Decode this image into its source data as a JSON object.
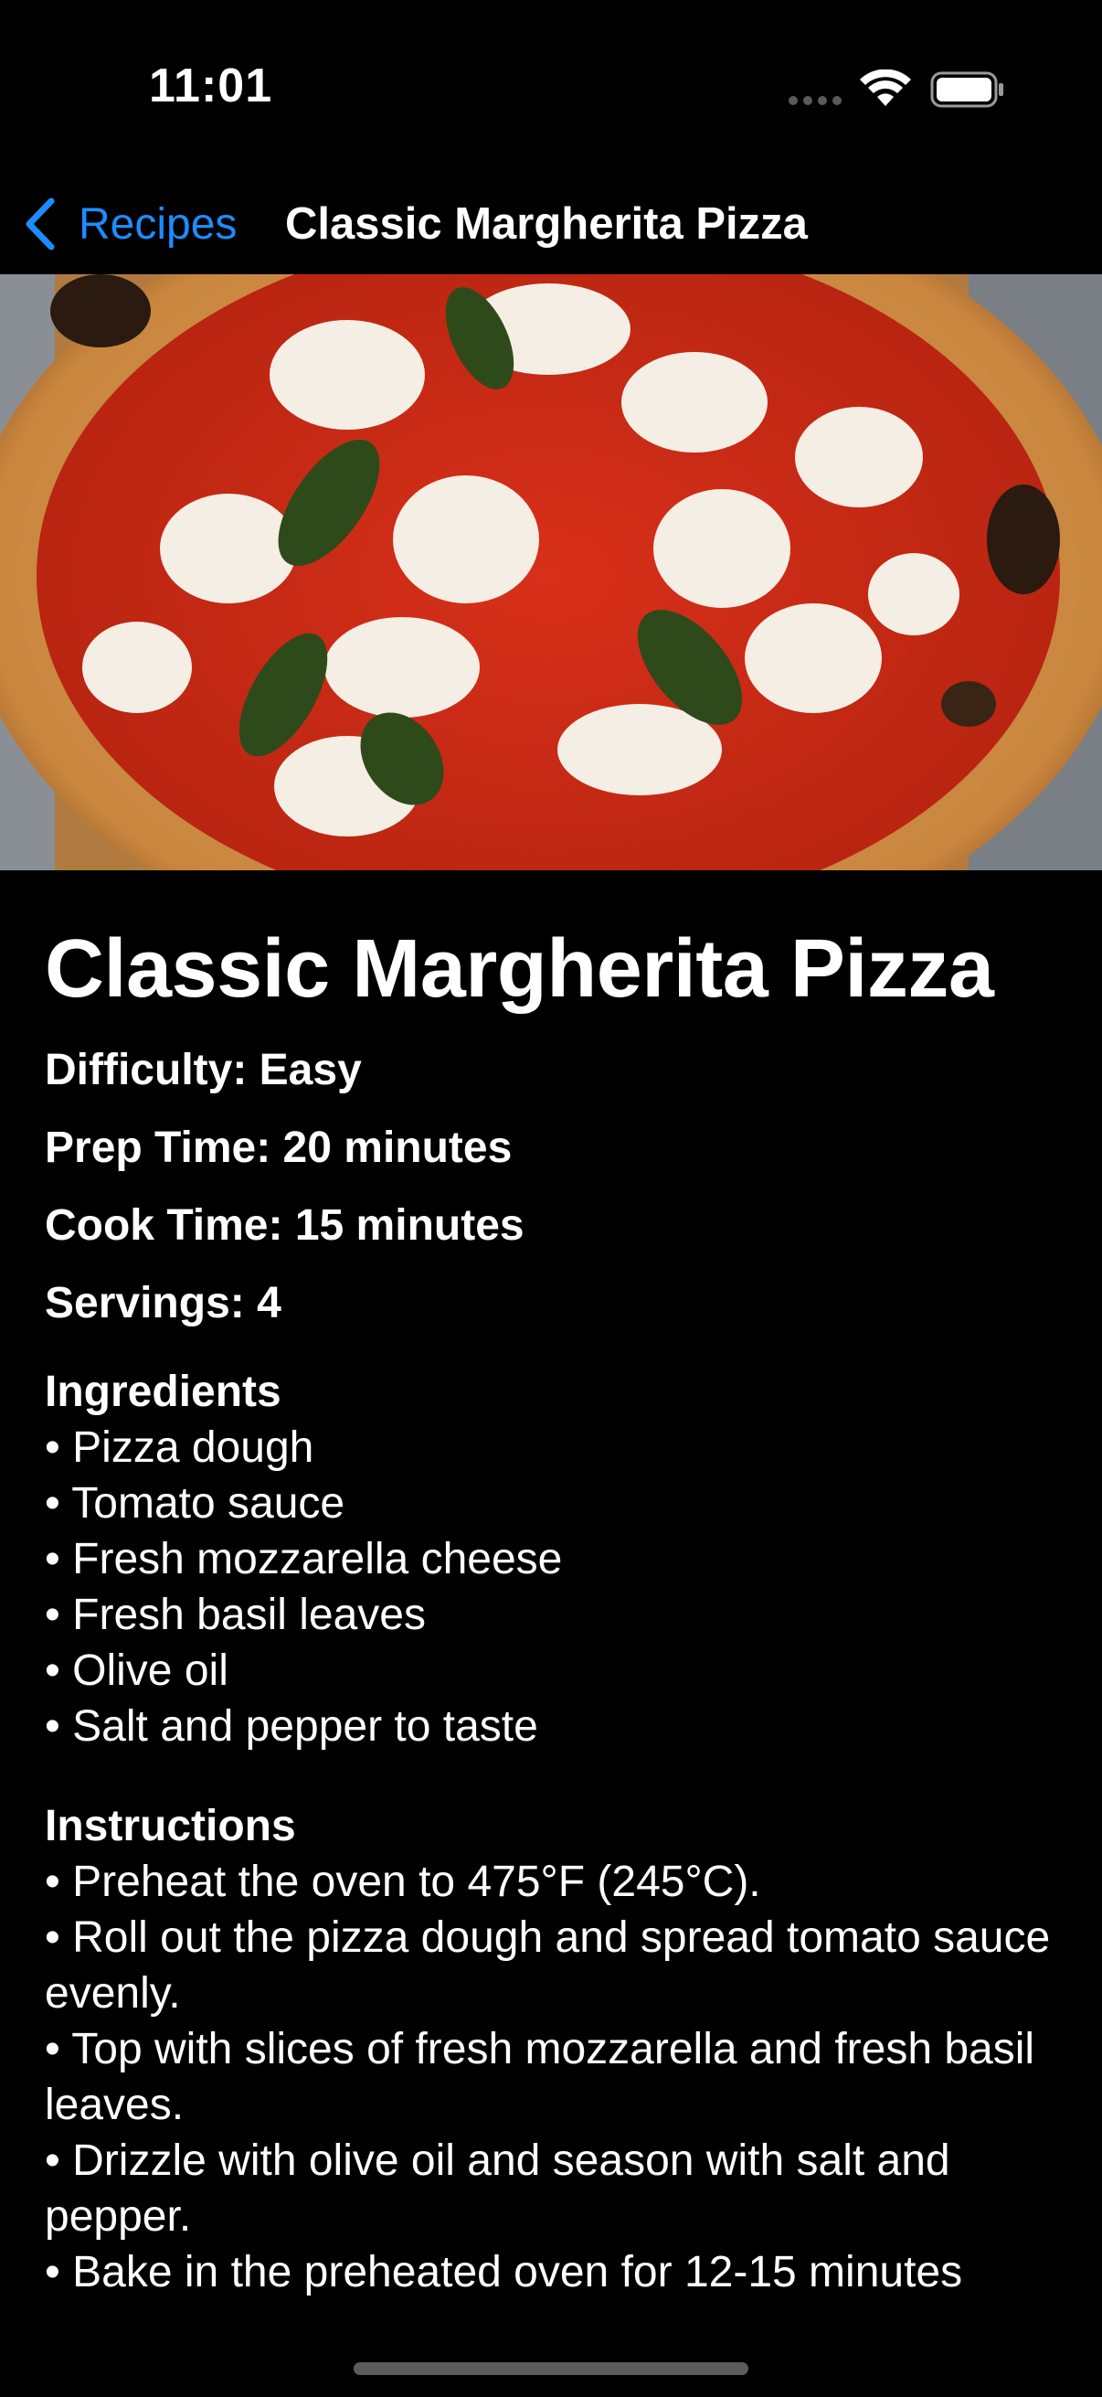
{
  "status_bar": {
    "time": "11:01",
    "icons": [
      "signal-dots-icon",
      "wifi-icon",
      "battery-icon"
    ]
  },
  "nav": {
    "back_label": "Recipes",
    "title": "Classic Margherita Pizza",
    "accent_color": "#1d8cff"
  },
  "hero_image": {
    "subject": "margherita-pizza-photo"
  },
  "recipe": {
    "title": "Classic Margherita Pizza",
    "difficulty": "Difficulty: Easy",
    "prep_time": "Prep Time: 20 minutes",
    "cook_time": "Cook Time: 15 minutes",
    "servings": "Servings: 4",
    "ingredients_heading": "Ingredients",
    "ingredients": [
      "Pizza dough",
      "Tomato sauce",
      "Fresh mozzarella cheese",
      "Fresh basil leaves",
      "Olive oil",
      "Salt and pepper to taste"
    ],
    "instructions_heading": "Instructions",
    "instructions": [
      "Preheat the oven to 475°F (245°C).",
      "Roll out the pizza dough and spread tomato sauce evenly.",
      "Top with slices of fresh mozzarella and fresh basil leaves.",
      "Drizzle with olive oil and season with salt and pepper.",
      "Bake in the preheated oven for 12-15 minutes"
    ]
  }
}
